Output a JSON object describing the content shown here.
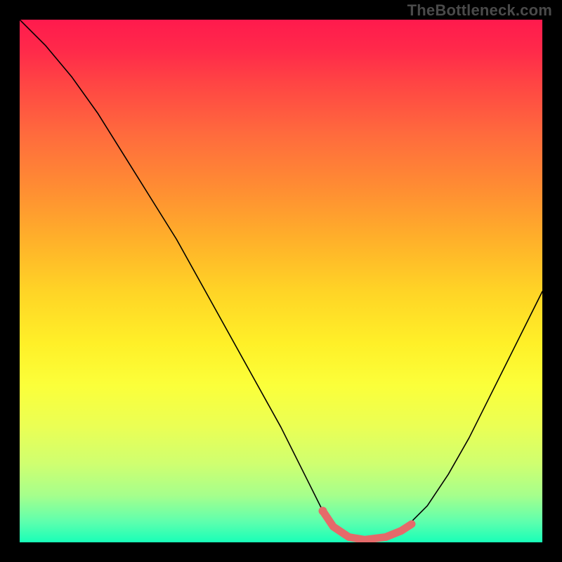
{
  "watermark": "TheBottleneck.com",
  "chart_data": {
    "type": "line",
    "title": "",
    "xlabel": "",
    "ylabel": "",
    "xlim": [
      0,
      100
    ],
    "ylim": [
      0,
      100
    ],
    "grid": false,
    "legend": false,
    "series": [
      {
        "name": "curve",
        "x": [
          0,
          5,
          10,
          15,
          20,
          25,
          30,
          35,
          40,
          45,
          50,
          55,
          58,
          60,
          63,
          66,
          70,
          74,
          78,
          82,
          86,
          90,
          94,
          100
        ],
        "values": [
          100,
          95,
          89,
          82,
          74,
          66,
          58,
          49,
          40,
          31,
          22,
          12,
          6,
          3,
          1,
          0.5,
          1,
          3,
          7,
          13,
          20,
          28,
          36,
          48
        ]
      }
    ],
    "highlight_segment": {
      "x": [
        58,
        60,
        63,
        66,
        70,
        73,
        75
      ],
      "values": [
        6,
        3,
        1,
        0.5,
        1,
        2.2,
        3.5
      ]
    },
    "background_gradient_stops": [
      {
        "pos": 0,
        "color": "#ff1a4d"
      },
      {
        "pos": 12,
        "color": "#ff4444"
      },
      {
        "pos": 32,
        "color": "#ff8c33"
      },
      {
        "pos": 52,
        "color": "#ffd426"
      },
      {
        "pos": 70,
        "color": "#fbff3a"
      },
      {
        "pos": 85,
        "color": "#cfff70"
      },
      {
        "pos": 100,
        "color": "#18ffb8"
      }
    ]
  }
}
